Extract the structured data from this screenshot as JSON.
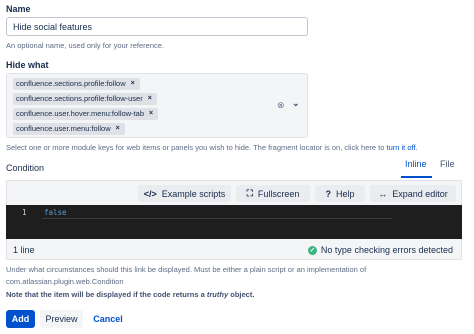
{
  "name": {
    "label": "Name",
    "value": "Hide social features",
    "help": "An optional name, used only for your reference."
  },
  "hide_what": {
    "label": "Hide what",
    "chips": [
      "confluence.sections.profile:follow",
      "confluence.sections.profile:follow-user",
      "confluence.user.hover.menu:follow-tab",
      "confluence.user.menu:follow"
    ],
    "remove_glyph": "×",
    "clear_glyph": "⊗",
    "dropdown_glyph": "⌄",
    "help_prefix": "Select one or more module keys for web items or panels you wish to hide. The fragment locator is on, click here to",
    "help_link": "turn it off",
    "help_suffix": "."
  },
  "condition": {
    "label": "Condition",
    "tabs": [
      "Inline",
      "File"
    ],
    "active_tab": "Inline",
    "toolbar": {
      "example_scripts": "Example scripts",
      "fullscreen": "Fullscreen",
      "help": "Help",
      "expand_editor": "Expand editor"
    },
    "icons": {
      "example_scripts": "</>",
      "fullscreen": "⛶",
      "help": "?",
      "expand_editor": "↔"
    },
    "code": {
      "line_number": "1",
      "text": "false"
    },
    "status": {
      "lines": "1 line",
      "type_check": "No type checking errors detected",
      "ok_glyph": "✓"
    },
    "help_line1": "Under what circumstances should this link be displayed. Must be either a plain script or an implementation of",
    "help_line2": "com.atlassian.plugin.web.Condition",
    "note_prefix": "Note that the item will be displayed if the code returns a",
    "note_italic": "truthy",
    "note_suffix": "object."
  },
  "actions": {
    "add": "Add",
    "preview": "Preview",
    "cancel": "Cancel"
  },
  "colors": {
    "primary": "#0052cc",
    "success": "#36b37e",
    "editor_bg": "#1e1e1e",
    "keyword": "#569cd6"
  }
}
